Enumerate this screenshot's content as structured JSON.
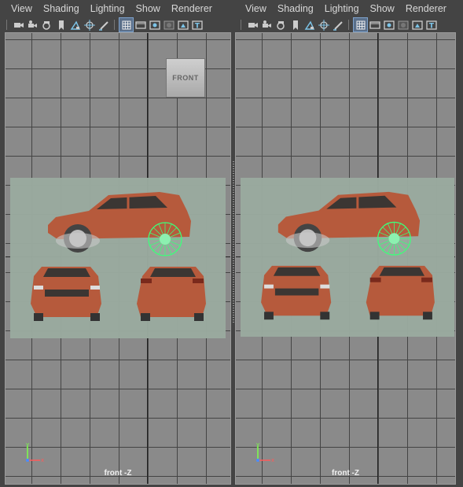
{
  "panels": [
    {
      "menu": [
        "View",
        "Shading",
        "Lighting",
        "Show",
        "Renderer"
      ],
      "camera_label": "front -Z",
      "view_cube_label": "FRONT"
    },
    {
      "menu": [
        "View",
        "Shading",
        "Lighting",
        "Show",
        "Renderer"
      ],
      "camera_label": "front -Z"
    }
  ],
  "toolbar_icons": [
    "camera-icon",
    "camera-attributes-icon",
    "bookmark-icon",
    "image-plane-icon",
    "select-camera-icon",
    "pan-zoom-icon",
    "grease-pencil-icon",
    "grid-icon",
    "film-gate-icon",
    "resolution-gate-icon",
    "gate-mask-icon",
    "safe-action-icon",
    "safe-title-icon"
  ],
  "axis_labels": {
    "y": "y",
    "x": "x"
  },
  "colors": {
    "viewport_bg": "#8a8a8a",
    "grid_line": "#444444",
    "car_body": "#b65a3c",
    "reference_plane": "#9aaa9f",
    "selection_green": "#3dff7a",
    "active_toggle": "#5a6f8a"
  }
}
